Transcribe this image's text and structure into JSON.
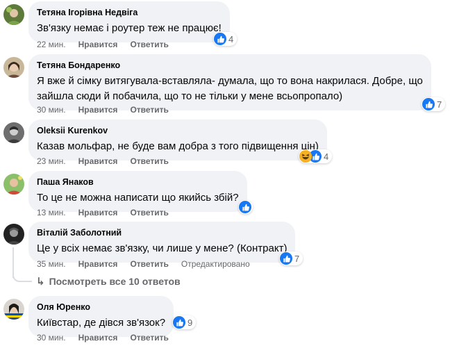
{
  "comments": [
    {
      "author": "Тетяна Ігорівна Недвіга",
      "text_lines": [
        "Зв'язку немає і роутер теж не працює!"
      ],
      "time": "22 мин.",
      "like_label": "Нравится",
      "reply_label": "Ответить",
      "reactions": [
        "like"
      ],
      "reaction_count": "4"
    },
    {
      "author": "Тетяна Бондаренко",
      "text_lines": [
        "Я вже й сімку витягувала-вставляла- думала, що то вона накрилася. Добре, що",
        "зайшла сюди й побачила, що то не тільки у мене всьопропало)"
      ],
      "time": "30 мин.",
      "like_label": "Нравится",
      "reply_label": "Ответить",
      "reactions": [
        "like"
      ],
      "reaction_count": "7"
    },
    {
      "author": "Oleksii Kurenkov",
      "text_lines": [
        "Казав мольфар, не буде вам добра з того підвищення цін)"
      ],
      "time": "23 мин.",
      "like_label": "Нравится",
      "reply_label": "Ответить",
      "reactions": [
        "haha",
        "like"
      ],
      "reaction_count": "4"
    },
    {
      "author": "Паша Янаков",
      "text_lines": [
        "То це не можна написати що якийсь збій?"
      ],
      "time": "13 мин.",
      "like_label": "Нравится",
      "reply_label": "Ответить",
      "reactions": [
        "like"
      ],
      "reaction_count": ""
    },
    {
      "author": "Віталій Заболотний",
      "text_lines": [
        "Це у всіх немає зв'язку, чи лише у мене? (Контракт)"
      ],
      "time": "35 мин.",
      "like_label": "Нравится",
      "reply_label": "Ответить",
      "edited_label": "Отредактировано",
      "reactions": [
        "like"
      ],
      "reaction_count": "7"
    },
    {
      "author": "Оля Юренко",
      "text_lines": [
        "Київстар, де дівся зв'язок?"
      ],
      "time": "30 мин.",
      "like_label": "Нравится",
      "reply_label": "Ответить",
      "reactions": [
        "like"
      ],
      "reaction_count": "9"
    }
  ],
  "view_replies": {
    "label": "Посмотреть все 10 ответов",
    "icon": "reply-arrow-icon"
  },
  "colors": {
    "bubble": "#f0f2f5",
    "like_blue": "#1877f2",
    "meta_gray": "#65676b"
  }
}
